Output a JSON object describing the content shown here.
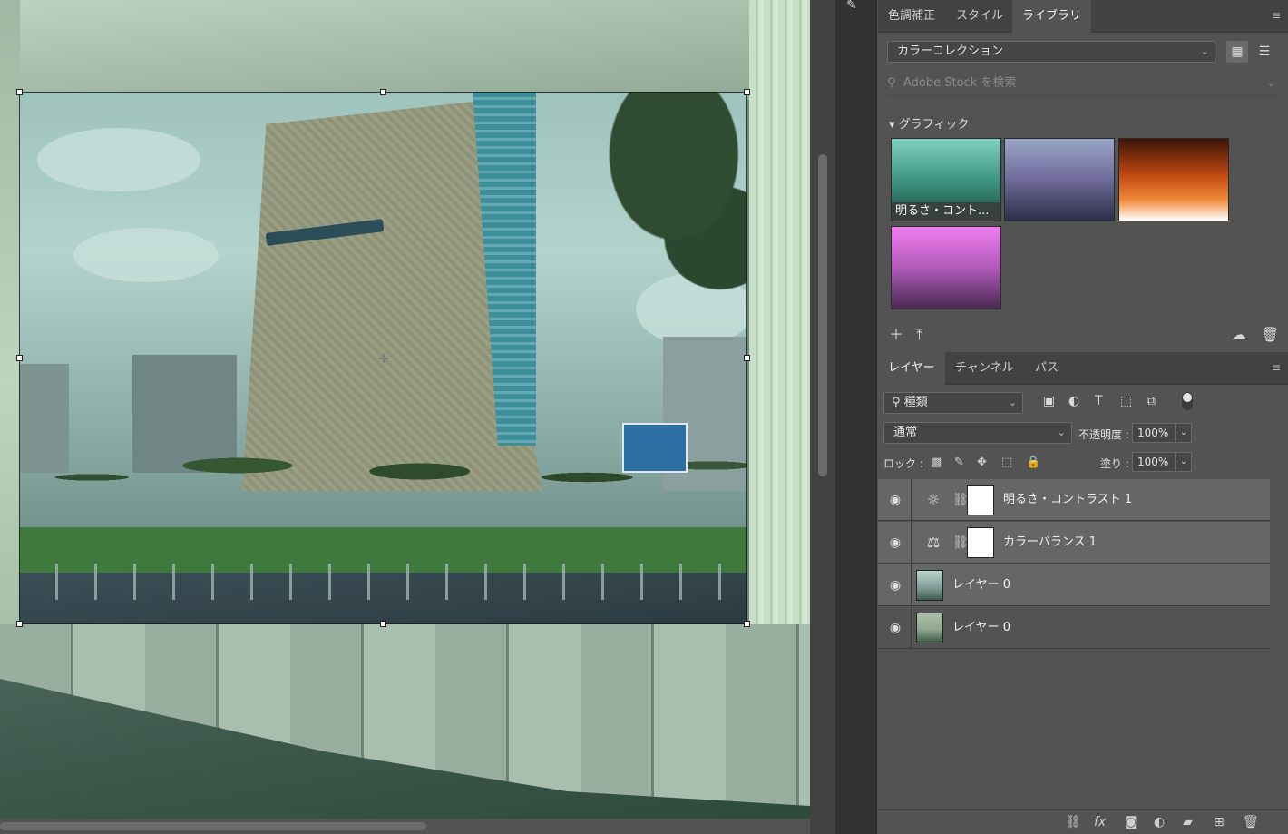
{
  "library_panel": {
    "tabs": [
      {
        "label": "色調補正"
      },
      {
        "label": "スタイル"
      },
      {
        "label": "ライブラリ"
      }
    ],
    "active_tab": "ライブラリ",
    "collection_select": "カラーコレクション",
    "search_placeholder": "Adobe Stock を検索",
    "group_title": "グラフィック",
    "graphics": [
      {
        "label": "明るさ・コント..."
      },
      {
        "label": ""
      },
      {
        "label": ""
      },
      {
        "label": ""
      }
    ],
    "icons": {
      "collapse": "triangle-down-icon",
      "search": "search-icon",
      "add": "plus-icon",
      "upload": "upload-icon",
      "creative_cloud": "creative-cloud-icon",
      "trash": "trash-icon",
      "grid_view": "grid-view-icon",
      "list_view": "list-view-icon"
    }
  },
  "layers_panel": {
    "tabs": [
      {
        "label": "レイヤー"
      },
      {
        "label": "チャンネル"
      },
      {
        "label": "パス"
      }
    ],
    "active_tab": "レイヤー",
    "filter_select": "種類",
    "blend_mode": "通常",
    "opacity_label": "不透明度 :",
    "opacity_value": "100%",
    "lock_label": "ロック :",
    "fill_label": "塗り :",
    "fill_value": "100%",
    "layers": [
      {
        "name": "明るさ・コントラスト 1",
        "type": "adjustment",
        "icon": "brightness-icon"
      },
      {
        "name": "カラーバランス 1",
        "type": "adjustment",
        "icon": "balance-scale-icon"
      },
      {
        "name": "レイヤー 0",
        "type": "pixel"
      },
      {
        "name": "レイヤー 0",
        "type": "pixel"
      }
    ]
  },
  "colors": {
    "panel_bg": "#535353",
    "tab_bg": "#424242",
    "selected_row": "#666666"
  }
}
